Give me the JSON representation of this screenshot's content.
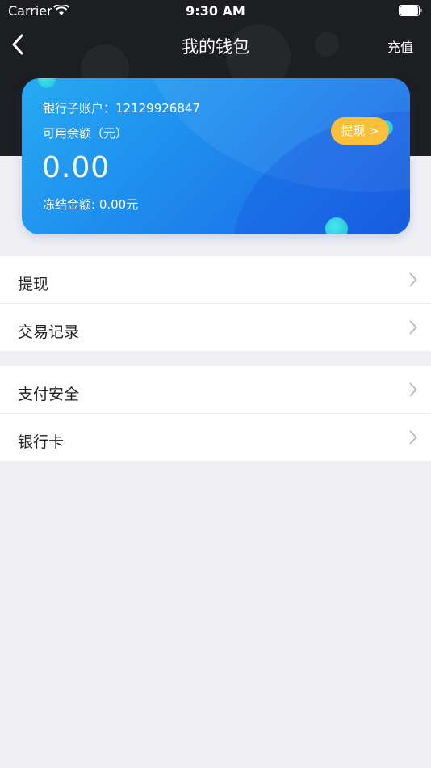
{
  "status_bar": {
    "carrier": "Carrier",
    "time": "9:30 AM"
  },
  "nav": {
    "title": "我的钱包",
    "right_action": "充值"
  },
  "wallet_card": {
    "account": "银行子账户：12129926847",
    "balance_label": "可用余额（元）",
    "balance": "0.00",
    "frozen": "冻结金额: 0.00元",
    "withdraw_button": "提现 >"
  },
  "menu_groups": [
    {
      "items": [
        "提现",
        "交易记录"
      ]
    },
    {
      "items": [
        "支付安全",
        "银行卡"
      ]
    }
  ],
  "colors": {
    "header_bg": "#1d1e21",
    "card_gradient_start": "#26aaf2",
    "card_gradient_end": "#1a63e4",
    "withdraw_button": "#fbbf3a",
    "page_bg": "#efeff4"
  }
}
